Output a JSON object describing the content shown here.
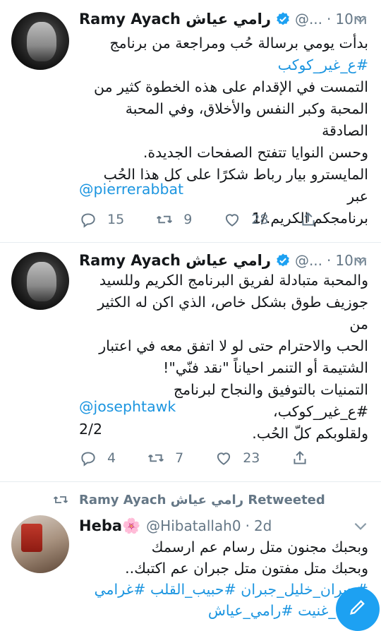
{
  "tweets": [
    {
      "name": "Ramy Ayach رامي عياش",
      "handle": "@...",
      "time": "10m",
      "body_lines": [
        "بدأت يومي برسالة حُب ومراجعة من برنامج",
        "#ع_غير_كوكب",
        "التمست في الإقدام على هذه الخطوة كثير من",
        "المحبة وكبر النفس والأخلاق، وفي المحبة الصادقة",
        "وحسن النوايا تتفتح الصفحات الجديدة.",
        "المايسترو بيار رباط شكرًا على كل هذا الحُب عبر",
        "برنامجكم الكريم./1"
      ],
      "mention": "@pierrerabbat",
      "replies": "15",
      "retweets": "9",
      "likes": "28"
    },
    {
      "name": "Ramy Ayach رامي عياش",
      "handle": "@...",
      "time": "10m",
      "body_lines": [
        "والمحبة متبادلة لفريق البرنامج الكريم وللسيد",
        "جوزيف طوق بشكل خاص، الذي اكن له الكثير من",
        "الحب والاحترام حتى لو لا اتفق معه في اعتبار",
        "الشتيمة أو التنمر احياناً \"نقد فنّي\"!",
        "التمنيات بالتوفيق والنجاح لبرنامج #ع_غير_كوكب،",
        "ولقلوبكم كلّ الحُب."
      ],
      "mention": "@josephtawk",
      "footer": "2/2",
      "replies": "4",
      "retweets": "7",
      "likes": "23"
    }
  ],
  "retweet_banner": "Ramy Ayach رامي عياش Retweeted",
  "third": {
    "name": "Heba🌸",
    "handle": "@Hibatallah0",
    "time": "2d",
    "line1": "وبحبك مجنون متل رسام عم ارسمك",
    "line2": "وبحبك متل مفتون متل جبران عم اكتبك..",
    "line3": "#جبران_خليل_جبران #حبيب_القلب #غرامي",
    "line4": "#الك_غنيت #رامي_عياش"
  },
  "colors": {
    "accent": "#1da1f2",
    "link": "#1b95e0",
    "muted": "#657786"
  }
}
